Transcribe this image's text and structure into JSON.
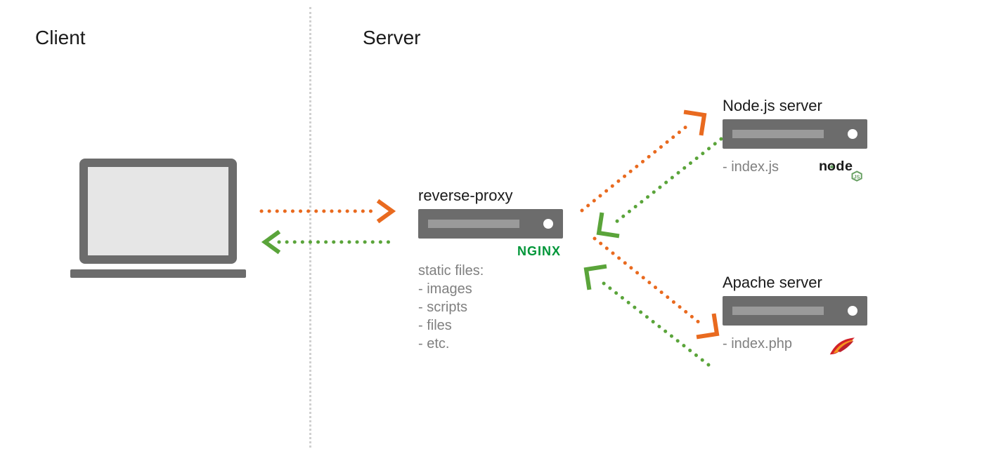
{
  "headings": {
    "client": "Client",
    "server": "Server"
  },
  "client": {
    "icon": "laptop"
  },
  "proxy": {
    "title": "reverse-proxy",
    "brand": "NGINX",
    "static_title": "static files:",
    "static_items": [
      "- images",
      "- scripts",
      "- files",
      "- etc."
    ]
  },
  "backends": {
    "node": {
      "title": "Node.js server",
      "file": "- index.js",
      "brand": "node"
    },
    "apache": {
      "title": "Apache server",
      "file": "- index.php",
      "brand": "apache"
    }
  },
  "colors": {
    "request": "#e96a1f",
    "response": "#5aa43a",
    "metal": "#6c6c6c",
    "text_muted": "#808080",
    "nginx": "#009639"
  },
  "arrows": [
    {
      "name": "client-to-proxy",
      "dir": "request"
    },
    {
      "name": "proxy-to-client",
      "dir": "response"
    },
    {
      "name": "proxy-to-node",
      "dir": "request"
    },
    {
      "name": "node-to-proxy",
      "dir": "response"
    },
    {
      "name": "proxy-to-apache",
      "dir": "request"
    },
    {
      "name": "apache-to-proxy",
      "dir": "response"
    }
  ]
}
